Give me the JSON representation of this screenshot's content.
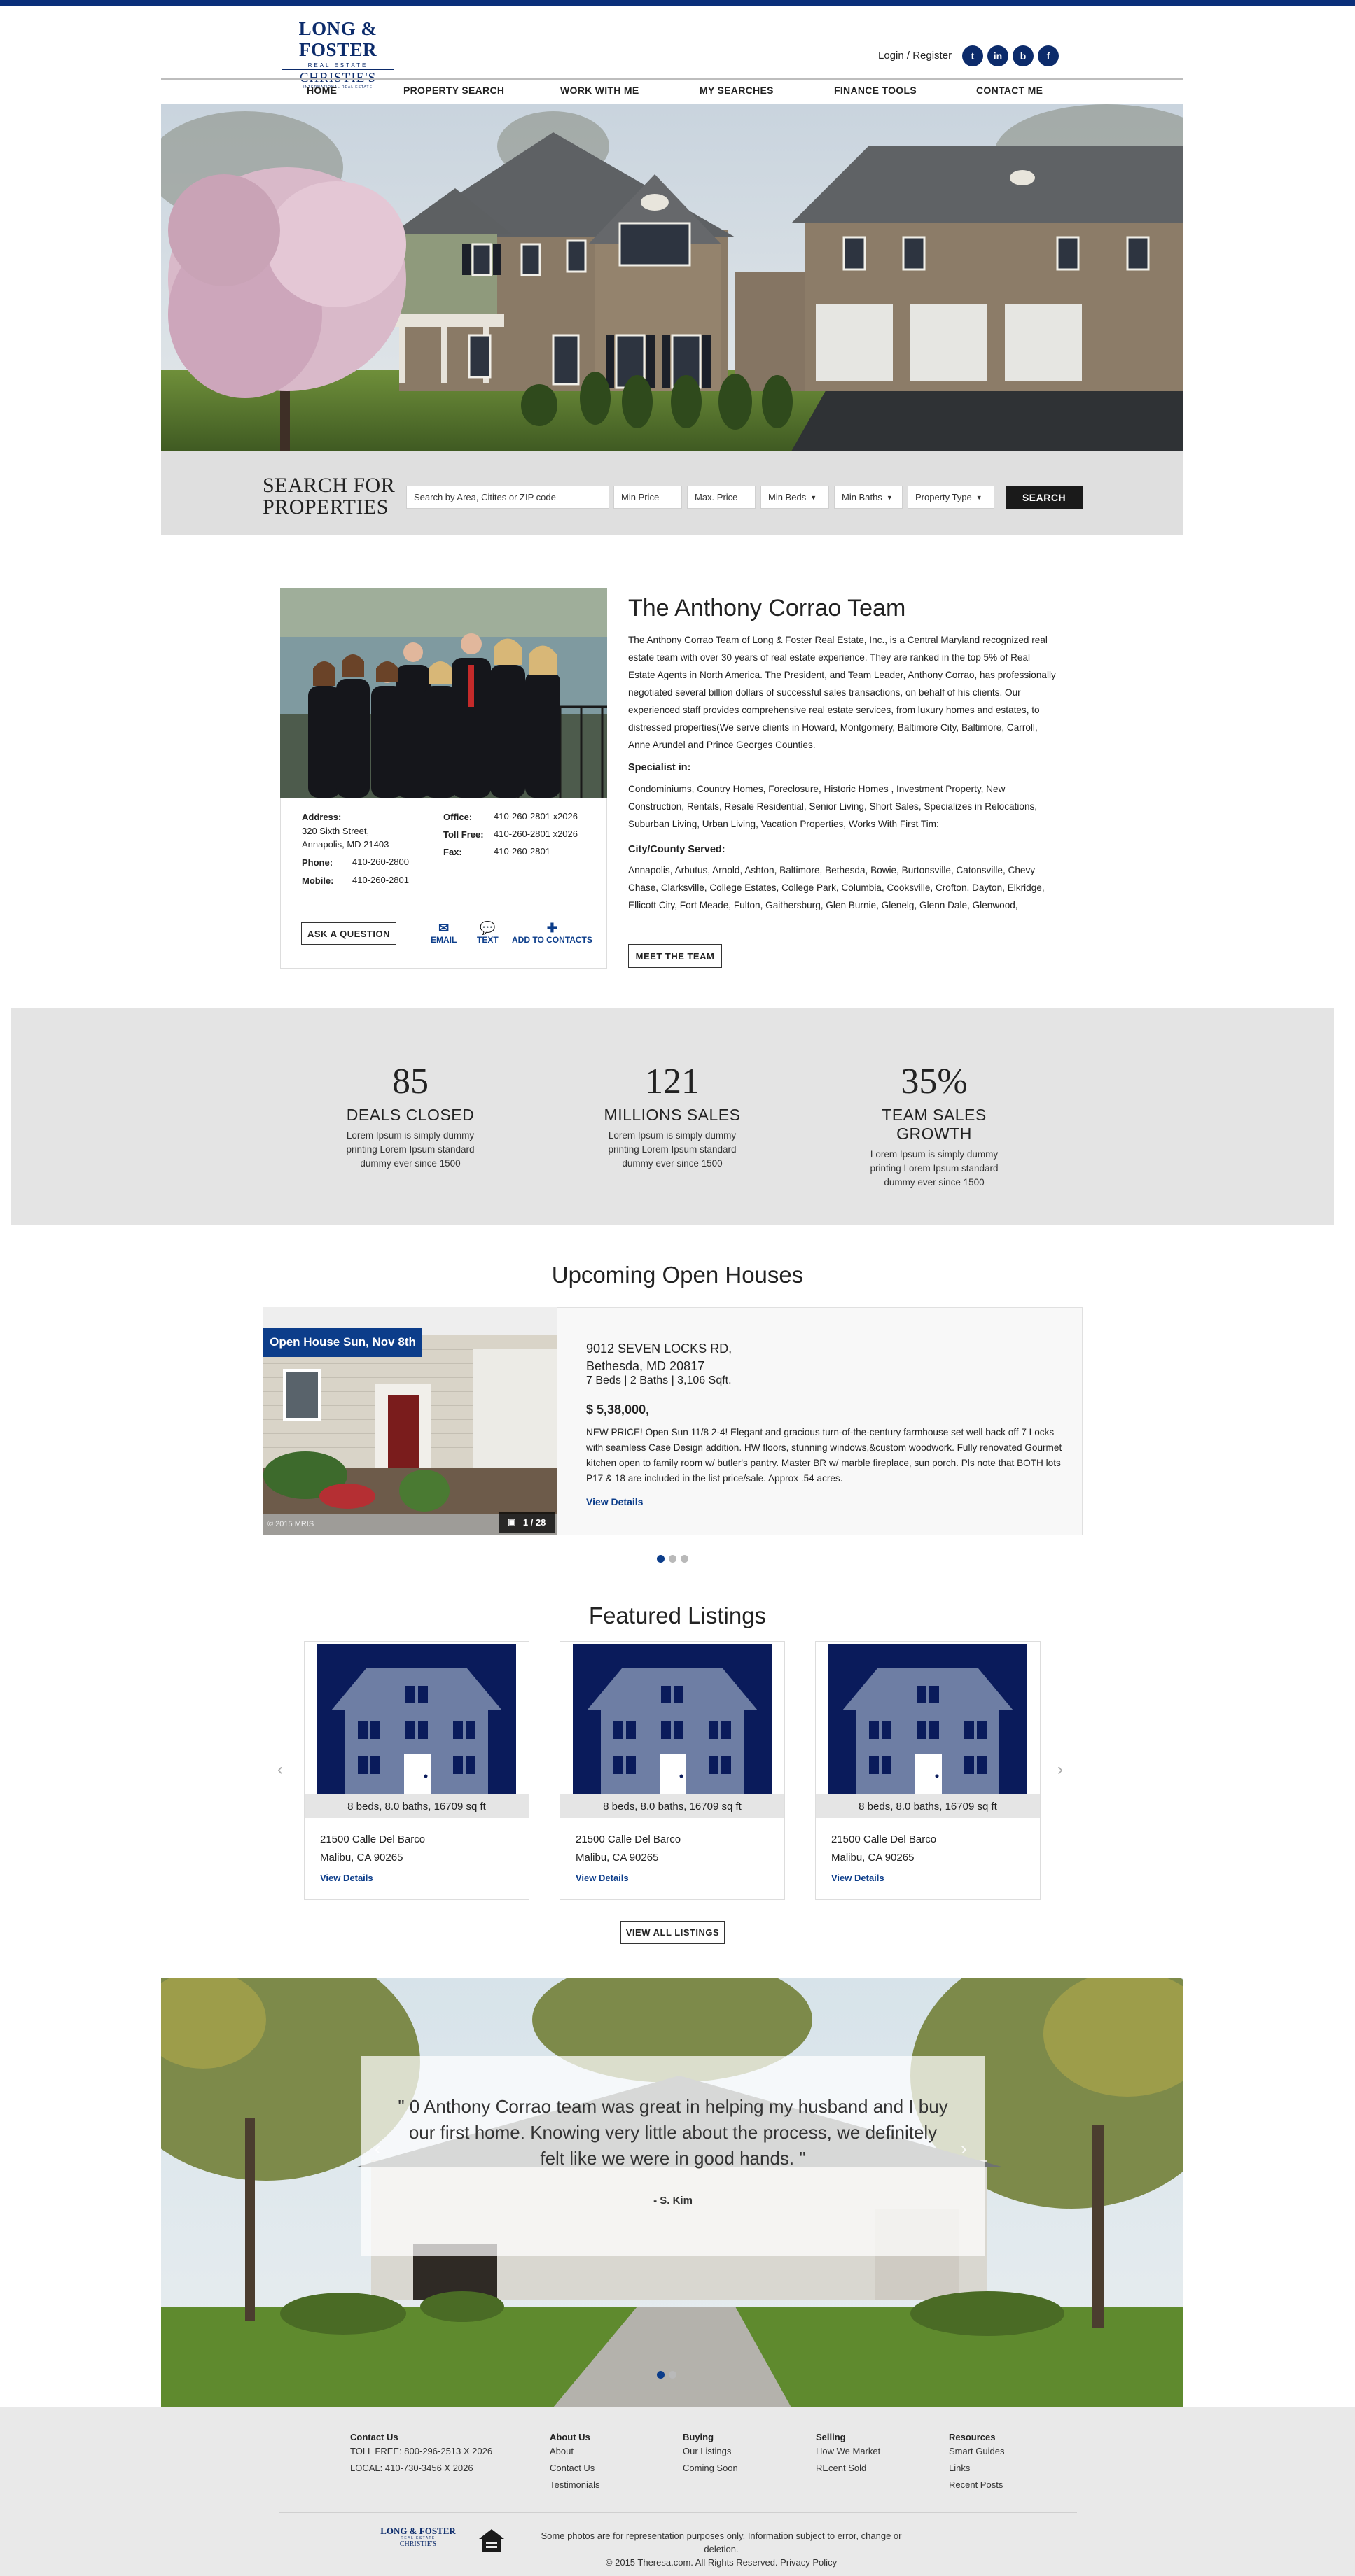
{
  "colors": {
    "brand": "#0c2b6b",
    "accent": "#0c3d8a",
    "topbar": "#0a2f7a"
  },
  "header": {
    "logo": {
      "line1": "LONG & FOSTER",
      "line2": "REAL ESTATE",
      "line3": "CHRISTIE'S",
      "line4": "INTERNATIONAL REAL ESTATE"
    },
    "login_label": "Login / Register",
    "social": [
      {
        "icon": "twitter-icon",
        "glyph": "t"
      },
      {
        "icon": "linkedin-icon",
        "glyph": "in"
      },
      {
        "icon": "blogger-icon",
        "glyph": "b"
      },
      {
        "icon": "facebook-icon",
        "glyph": "f"
      }
    ]
  },
  "nav": {
    "items": [
      "HOME",
      "PROPERTY SEARCH",
      "WORK WITH ME",
      "MY SEARCHES",
      "FINANCE TOOLS",
      "CONTACT ME"
    ]
  },
  "search": {
    "title_line1": "SEARCH FOR",
    "title_line2": "PROPERTIES",
    "location_placeholder": "Search by Area, Citites or ZIP code",
    "min_price_placeholder": "Min Price",
    "max_price_placeholder": "Max. Price",
    "min_beds_label": "Min Beds",
    "min_baths_label": "Min Baths",
    "property_type_label": "Property Type",
    "button_label": "SEARCH"
  },
  "team": {
    "title": "The Anthony Corrao Team",
    "bio": "The Anthony Corrao Team of Long & Foster Real Estate, Inc., is a Central Maryland recognized real estate team with over 30 years of real estate experience. They are ranked in the top 5% of Real Estate Agents in North America. The President, and Team Leader, Anthony Corrao, has professionally negotiated several billion dollars of successful sales transactions, on behalf of his clients. Our experienced staff provides comprehensive real estate services, from luxury homes and estates, to distressed properties(We serve clients in Howard, Montgomery, Baltimore City, Baltimore, Carroll, Anne Arundel and Prince Georges Counties.",
    "specialist_heading": "Specialist in:",
    "specialist_text": "Condominiums, Country Homes, Foreclosure, Historic Homes , Investment Property, New Construction, Rentals, Resale Residential, Senior Living, Short Sales, Specializes in Relocations, Suburban Living, Urban Living, Vacation Properties, Works With First Tim:",
    "served_heading": "City/County Served:",
    "served_text": "Annapolis, Arbutus, Arnold, Ashton, Baltimore, Bethesda, Bowie, Burtonsville, Catonsville, Chevy Chase, Clarksville, College Estates, College Park, Columbia, Cooksville, Crofton, Dayton, Elkridge, Ellicott City, Fort Meade, Fulton, Gaithersburg, Glen Burnie, Glenelg, Glenn Dale, Glenwood,",
    "meet_button": "MEET THE TEAM",
    "contact": {
      "address_label": "Address:",
      "address_line1": "320 Sixth Street,",
      "address_line2": "Annapolis, MD 21403",
      "phone_label": "Phone:",
      "phone": "410-260-2800",
      "mobile_label": "Mobile:",
      "mobile": "410-260-2801",
      "office_label": "Office:",
      "office": "410-260-2801 x2026",
      "tollfree_label": "Toll Free:",
      "tollfree": "410-260-2801 x2026",
      "fax_label": "Fax:",
      "fax": "410-260-2801"
    },
    "ask_button": "ASK A QUESTION",
    "actions": {
      "email": "EMAIL",
      "text": "TEXT",
      "add": "ADD TO CONTACTS"
    }
  },
  "stats": [
    {
      "number": "85",
      "label": "DEALS CLOSED",
      "desc": "Lorem Ipsum is simply dummy printing Lorem Ipsum standard dummy ever since 1500"
    },
    {
      "number": "121",
      "label": "MILLIONS SALES",
      "desc": "Lorem Ipsum is simply dummy printing Lorem Ipsum standard dummy ever since 1500"
    },
    {
      "number": "35%",
      "label": "TEAM SALES GROWTH",
      "desc": "Lorem Ipsum is simply dummy printing Lorem Ipsum standard dummy ever since 1500"
    }
  ],
  "open_houses": {
    "title": "Upcoming Open Houses",
    "badge": "Open House Sun, Nov 8th",
    "photo_count": "1 / 28",
    "copyright": "© 2015 MRIS",
    "address_line1": "9012 SEVEN LOCKS RD,",
    "address_line2": "Bethesda, MD 20817",
    "details": "7 Beds | 2 Baths | 3,106 Sqft.",
    "price": "$ 5,38,000,",
    "description": "NEW PRICE! Open Sun 11/8 2-4! Elegant and gracious turn-of-the-century farmhouse set well back off 7 Locks with seamless Case Design addition. HW floors, stunning windows,&custom woodwork. Fully renovated Gourmet kitchen open to family room w/ butler's pantry. Master BR w/ marble fireplace, sun porch. Pls note that BOTH lots P17 & 18 are included in the list price/sale. Approx .54 acres.",
    "link": "View Details"
  },
  "featured": {
    "title": "Featured Listings",
    "listings": [
      {
        "meta": "8 beds, 8.0 baths, 16709 sq ft",
        "address_line1": "21500 Calle Del Barco",
        "address_line2": "Malibu, CA 90265",
        "link": "View Details"
      },
      {
        "meta": "8 beds, 8.0 baths, 16709 sq ft",
        "address_line1": "21500 Calle Del Barco",
        "address_line2": "Malibu, CA 90265",
        "link": "View Details"
      },
      {
        "meta": "8 beds, 8.0 baths, 16709 sq ft",
        "address_line1": "21500 Calle Del Barco",
        "address_line2": "Malibu, CA 90265",
        "link": "View Details"
      }
    ],
    "view_all": "VIEW ALL LISTINGS"
  },
  "testimonial": {
    "quote": "\" 0 Anthony Corrao team was great in helping my husband and I buy our first home. Knowing very little about the process, we definitely felt like we were in good hands. \"",
    "author": "- S. Kim"
  },
  "footer": {
    "contact": {
      "heading": "Contact Us",
      "items": [
        "TOLL FREE: 800-296-2513 X 2026",
        "LOCAL: 410-730-3456 X 2026"
      ]
    },
    "about": {
      "heading": "About Us",
      "items": [
        "About",
        "Contact Us",
        "Testimonials"
      ]
    },
    "buying": {
      "heading": "Buying",
      "items": [
        "Our Listings",
        "Coming Soon"
      ]
    },
    "selling": {
      "heading": "Selling",
      "items": [
        "How We Market",
        "REcent Sold"
      ]
    },
    "resources": {
      "heading": "Resources",
      "items": [
        "Smart Guides",
        "Links",
        "Recent Posts"
      ]
    },
    "logo": {
      "line1": "LONG & FOSTER",
      "line2": "REAL ESTATE",
      "line3": "CHRISTIE'S"
    },
    "disclaimer": "Some photos are for representation purposes only. Information subject to error, change or deletion.",
    "copyright": "© 2015 Theresa.com. All Rights Reserved. Privacy Policy"
  }
}
